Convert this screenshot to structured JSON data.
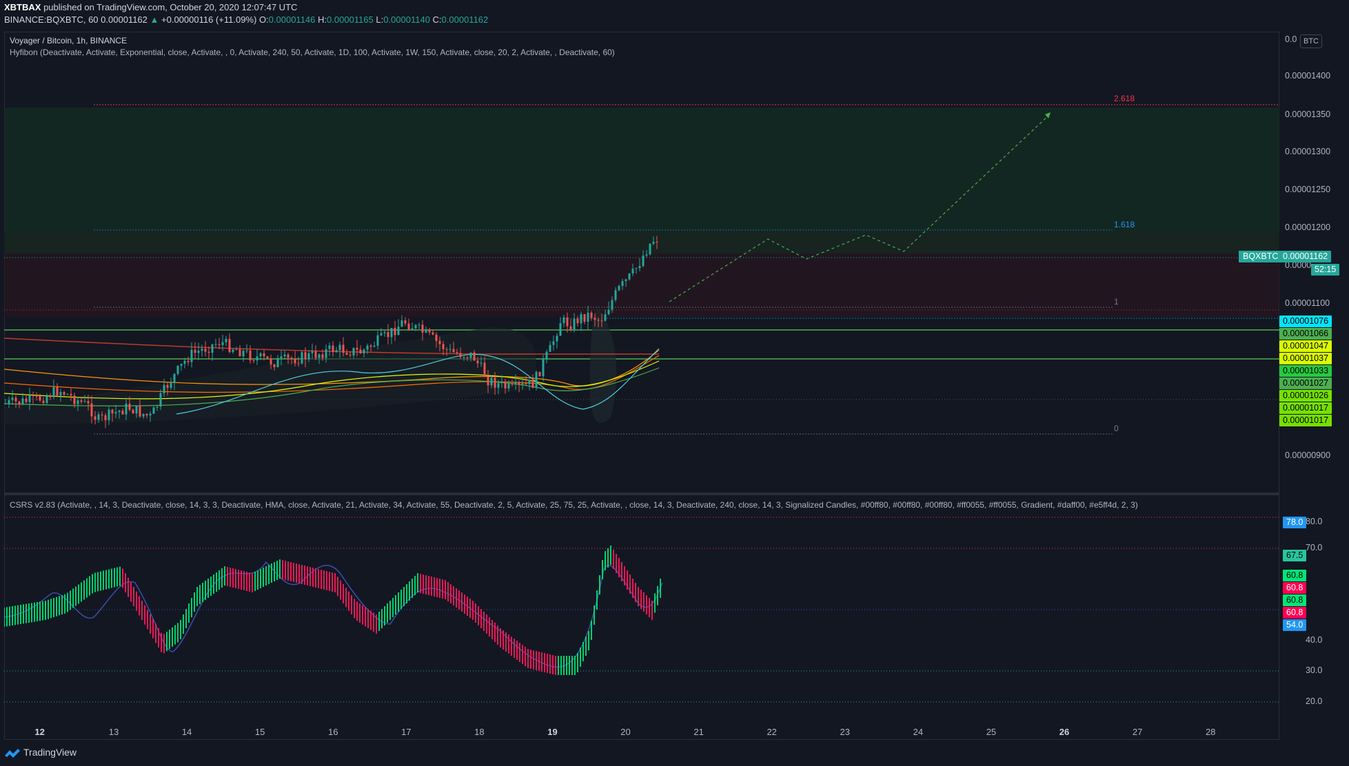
{
  "header": {
    "author": "XBTBAX",
    "published_text": "published on TradingView.com, October 20, 2020 12:07:47 UTC",
    "symbol_line": "BINANCE:BQXBTC, 60",
    "last_price": "0.00001162",
    "change": "+0.00000116 (+11.09%)",
    "o_label": "O:",
    "o_value": "0.00001146",
    "h_label": "H:",
    "h_value": "0.00001165",
    "l_label": "L:",
    "l_value": "0.00001140",
    "c_label": "C:",
    "c_value": "0.00001162"
  },
  "main_pane": {
    "title": "Voyager / Bitcoin, 1h, BINANCE",
    "indicator": "Hyfibon (Deactivate, Activate, Exponential, close, Activate, , 0, Activate, 240, 50, Activate, 1D, 100, Activate, 1W, 150, Activate, close, 20, 2, Activate, , Deactivate, 60)",
    "fib_levels": [
      {
        "label": "2.618",
        "color": "#f23645"
      },
      {
        "label": "1.618",
        "color": "#2196f3"
      },
      {
        "label": "1",
        "color": "#787b86"
      },
      {
        "label": "0",
        "color": "#787b86"
      }
    ]
  },
  "lower_pane": {
    "indicator": "CSRS v2.83 (Activate, , 14, 3, Deactivate, close, 14, 3, 3, Deactivate, HMA, close, Activate, 21, Activate, 34, Activate, 55, Deactivate, 2, 5, Activate, 25, 75, 25, Activate, , close, 14, 3, Deactivate, 240, close, 14, 3, Signalized Candles, #00ff80, #00ff80, #00ff80, #ff0055, #ff0055, Gradient, #daff00, #e5ff4d, 2, 3)"
  },
  "price_axis": {
    "currency": "BTC",
    "ticks": [
      "0.0",
      "0.00001400",
      "0.00001350",
      "0.00001300",
      "0.00001250",
      "0.00001200",
      "0.0000",
      "0.00001100",
      "0.00000900"
    ],
    "symbol_tag": "BQXBTC",
    "current_price": "0.00001162",
    "countdown": "52:15",
    "labels": [
      {
        "text": "0.00001076",
        "bg": "#00e5ff"
      },
      {
        "text": "0.00001066",
        "bg": "#4caf50"
      },
      {
        "text": "0.00001047",
        "bg": "#daff00"
      },
      {
        "text": "0.00001037",
        "bg": "#daff00"
      },
      {
        "text": "0.00001033",
        "bg": "#26c940"
      },
      {
        "text": "0.00001027",
        "bg": "#4caf50"
      },
      {
        "text": "0.00001026",
        "bg": "#76e000"
      },
      {
        "text": "0.00001017",
        "bg": "#76e000"
      },
      {
        "text": "0.00001017",
        "bg": "#76e000"
      }
    ]
  },
  "osc_axis": {
    "ticks": [
      "80.0",
      "70.0",
      "40.0",
      "30.0",
      "20.0"
    ],
    "labels": [
      {
        "text": "78.0",
        "bg": "#2196f3"
      },
      {
        "text": "67.5",
        "bg": "#26c6a0"
      },
      {
        "text": "60.8",
        "bg": "#00e676"
      },
      {
        "text": "60.8",
        "bg": "#ff0055"
      },
      {
        "text": "60.8",
        "bg": "#00e676"
      },
      {
        "text": "60.8",
        "bg": "#ff0055"
      },
      {
        "text": "54.0",
        "bg": "#2196f3"
      }
    ]
  },
  "time_axis": {
    "ticks": [
      {
        "label": "12",
        "bold": true
      },
      {
        "label": "13",
        "bold": false
      },
      {
        "label": "14",
        "bold": false
      },
      {
        "label": "15",
        "bold": false
      },
      {
        "label": "16",
        "bold": false
      },
      {
        "label": "17",
        "bold": false
      },
      {
        "label": "18",
        "bold": false
      },
      {
        "label": "19",
        "bold": true
      },
      {
        "label": "20",
        "bold": false
      },
      {
        "label": "21",
        "bold": false
      },
      {
        "label": "22",
        "bold": false
      },
      {
        "label": "23",
        "bold": false
      },
      {
        "label": "24",
        "bold": false
      },
      {
        "label": "25",
        "bold": false
      },
      {
        "label": "26",
        "bold": true
      },
      {
        "label": "27",
        "bold": false
      },
      {
        "label": "28",
        "bold": false
      }
    ]
  },
  "footer": {
    "brand": "TradingView"
  }
}
